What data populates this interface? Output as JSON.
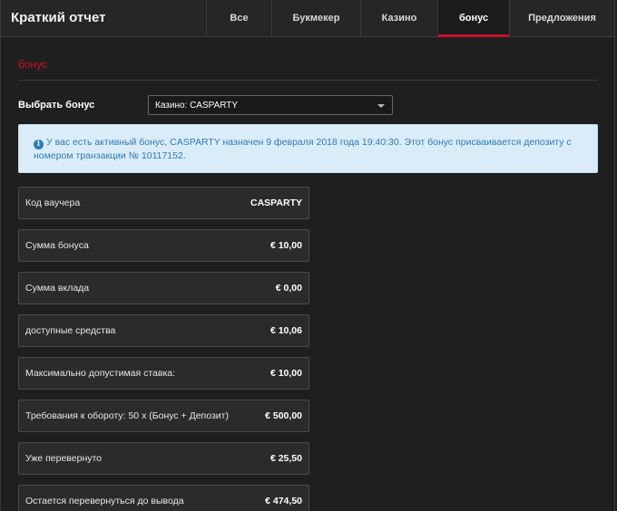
{
  "header": {
    "title": "Краткий отчет",
    "tabs": [
      {
        "label": "Все",
        "active": false
      },
      {
        "label": "Букмекер",
        "active": false
      },
      {
        "label": "Казино",
        "active": false
      },
      {
        "label": "бонус",
        "active": true
      },
      {
        "label": "Предложения",
        "active": false
      }
    ]
  },
  "section": {
    "title": "бонус"
  },
  "bonus_select": {
    "label": "Выбрать бонус",
    "selected": "Казино: CASPARTY"
  },
  "alert": {
    "icon": "info-icon",
    "text": "У вас есть активный бонус, CASPARTY назначен 9 февраля 2018 года 19:40:30. Этот бонус присваивается депозиту с номером транзакции № 10117152."
  },
  "details": [
    {
      "label": "Код ваучера",
      "value": "CASPARTY"
    },
    {
      "label": "Сумма бонуса",
      "value": "€ 10,00"
    },
    {
      "label": "Сумма вклада",
      "value": "€ 0,00"
    },
    {
      "label": "доступные средства",
      "value": "€ 10,06"
    },
    {
      "label": "Максимально допустимая ставка:",
      "value": "€ 10,00"
    },
    {
      "label": "Требования к обороту: 50 x (Бонус + Депозит)",
      "value": "€ 500,00"
    },
    {
      "label": "Уже перевернуто",
      "value": "€ 25,50"
    },
    {
      "label": "Остается перевернуться до вывода",
      "value": "€ 474,50"
    }
  ],
  "colors": {
    "accent": "#c8102e",
    "alert_bg": "#d9ecf8",
    "alert_text": "#2f7ab8"
  }
}
